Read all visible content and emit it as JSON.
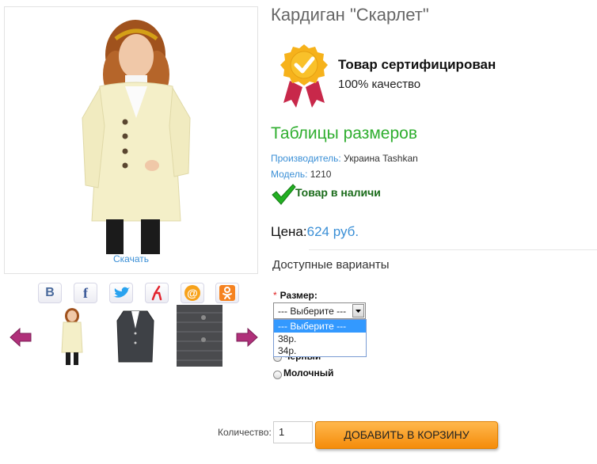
{
  "product": {
    "title": "Кардиган \"Скарлет\"",
    "download_label": "Скачать"
  },
  "certificate": {
    "title": "Товар сертифицирован",
    "subtitle": "100% качество"
  },
  "size_tables_link": "Таблицы размеров",
  "meta": {
    "manufacturer_label": "Производитель:",
    "manufacturer_value": "Украина Tashkan",
    "model_label": "Модель:",
    "model_value": "1210"
  },
  "stock_status": "Товар в наличи",
  "price": {
    "label": "Цена:",
    "value": "624 руб."
  },
  "variants": {
    "heading": "Доступные варианты",
    "size_required_mark": "*",
    "size_label": "Размер:",
    "size_selected": "--- Выберите ---",
    "size_options": [
      "--- Выберите ---",
      "38р.",
      "34р."
    ],
    "color_options": [
      "Черный",
      "Молочный"
    ]
  },
  "social_icons": [
    "vk-icon",
    "facebook-icon",
    "twitter-icon",
    "odnoklassniki-icon",
    "mailru-icon",
    "ok-icon"
  ],
  "social_glyphs": [
    "В",
    "f",
    "",
    "",
    "@",
    ""
  ],
  "quantity": {
    "label": "Количество:",
    "value": "1"
  },
  "add_to_cart_label": "ДОБАВИТЬ В КОРЗИНУ",
  "colors": {
    "accent_blue": "#3a8fd6",
    "green": "#2fae2f",
    "orange": "#f58c0a",
    "arrow_purple": "#b0307a"
  }
}
